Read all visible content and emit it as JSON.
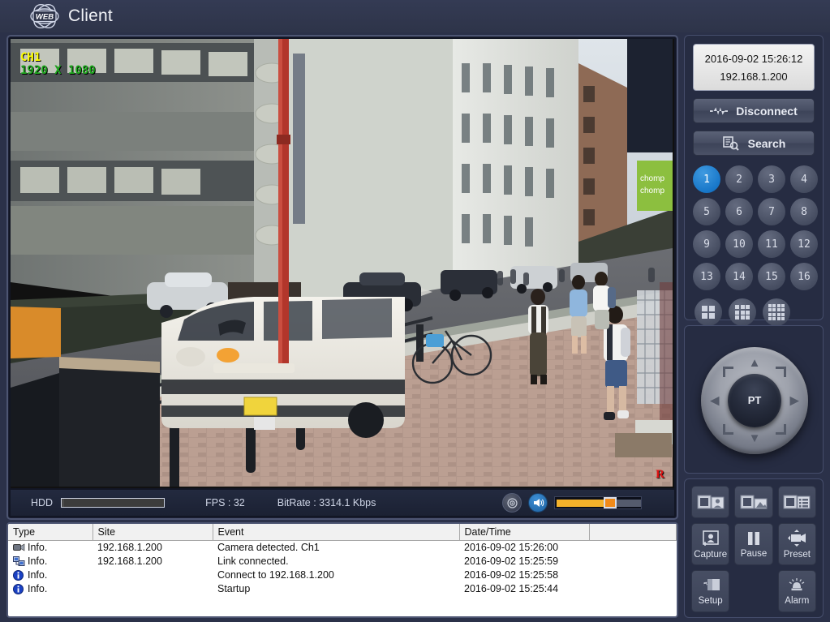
{
  "app": {
    "logo_badge": "WEB",
    "title": "Client"
  },
  "video": {
    "channel_label": "CH1",
    "resolution_label": "1920 X 1080",
    "recording_indicator": "R"
  },
  "statusbar": {
    "hdd_label": "HDD",
    "hdd_percent": 2,
    "fps_label": "FPS :",
    "fps_value": "32",
    "bitrate_label": "BitRate :",
    "bitrate_value": "3314.1 Kbps",
    "record_icon": "record-status-icon",
    "speaker_icon": "speaker-icon",
    "volume_percent": 62
  },
  "rightpanel": {
    "info": {
      "datetime": "2016-09-02 15:26:12",
      "ip": "192.168.1.200"
    },
    "buttons": [
      {
        "label": "Disconnect",
        "icon": "connection-waveform-icon"
      },
      {
        "label": "Search",
        "icon": "search-list-icon"
      }
    ],
    "channels": [
      {
        "label": "1",
        "active": true
      },
      {
        "label": "2",
        "active": false
      },
      {
        "label": "3",
        "active": false
      },
      {
        "label": "4",
        "active": false
      },
      {
        "label": "5",
        "active": false
      },
      {
        "label": "6",
        "active": false
      },
      {
        "label": "7",
        "active": false
      },
      {
        "label": "8",
        "active": false
      },
      {
        "label": "9",
        "active": false
      },
      {
        "label": "10",
        "active": false
      },
      {
        "label": "11",
        "active": false
      },
      {
        "label": "12",
        "active": false
      },
      {
        "label": "13",
        "active": false
      },
      {
        "label": "14",
        "active": false
      },
      {
        "label": "15",
        "active": false
      },
      {
        "label": "16",
        "active": false
      }
    ],
    "splits": [
      {
        "name": "split-4",
        "cols": 2
      },
      {
        "name": "split-9",
        "cols": 3
      },
      {
        "name": "split-16",
        "cols": 4
      }
    ],
    "ptz": {
      "center_label": "PT",
      "arrows": [
        "up",
        "down",
        "left",
        "right",
        "up-left",
        "up-right",
        "down-left",
        "down-right"
      ]
    },
    "tools_row1": [
      {
        "label": "",
        "icon": "ptz-camera-person-icon"
      },
      {
        "label": "",
        "icon": "ptz-camera-image-icon"
      },
      {
        "label": "",
        "icon": "ptz-camera-list-icon"
      }
    ],
    "tools_row2": [
      {
        "label": "Capture",
        "icon": "capture-icon"
      },
      {
        "label": "Pause",
        "icon": "pause-icon"
      },
      {
        "label": "Preset",
        "icon": "preset-camera-icon"
      }
    ],
    "tools_row3": [
      {
        "label": "Setup",
        "icon": "setup-gear-icon"
      },
      {
        "label": "",
        "icon": ""
      },
      {
        "label": "Alarm",
        "icon": "alarm-bell-icon"
      }
    ]
  },
  "log": {
    "columns": [
      "Type",
      "Site",
      "Event",
      "Date/Time",
      ""
    ],
    "rows": [
      {
        "icon": "camera-icon",
        "type": "Info.",
        "site": "192.168.1.200",
        "event": "Camera detected. Ch1",
        "datetime": "2016-09-02 15:26:00"
      },
      {
        "icon": "network-icon",
        "type": "Info.",
        "site": "192.168.1.200",
        "event": "Link connected.",
        "datetime": "2016-09-02 15:25:59"
      },
      {
        "icon": "info-icon",
        "type": "Info.",
        "site": "",
        "event": "Connect to 192.168.1.200",
        "datetime": "2016-09-02 15:25:58"
      },
      {
        "icon": "info-icon",
        "type": "Info.",
        "site": "",
        "event": "Startup",
        "datetime": "2016-09-02 15:25:44"
      }
    ]
  },
  "colors": {
    "accent": "#1877c9",
    "panel_bg": "#262c42",
    "app_bg": "#2b3149",
    "osd_channel": "#ffff00",
    "osd_resolution": "#1ea81e",
    "rec": "#e01414",
    "volume": "#f4b22b"
  }
}
